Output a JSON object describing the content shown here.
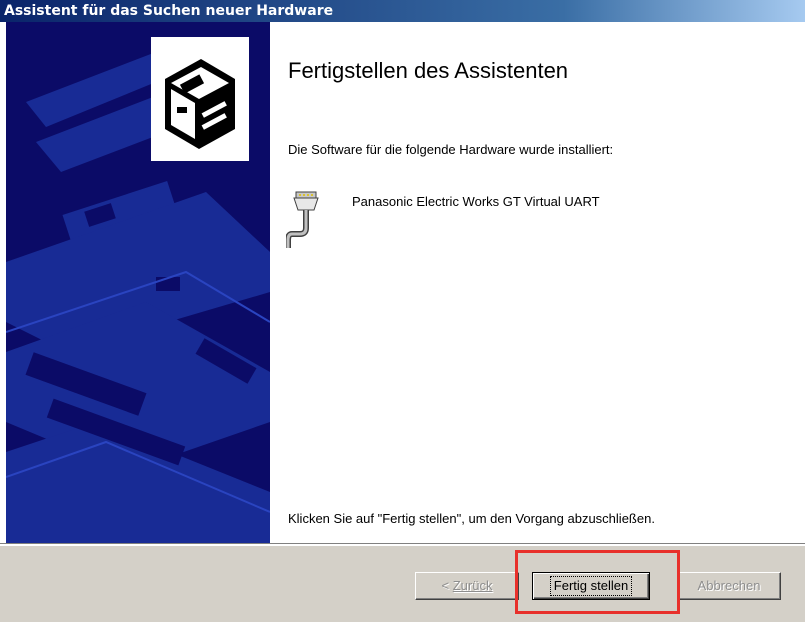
{
  "window": {
    "title": "Assistent für das Suchen neuer Hardware"
  },
  "wizard": {
    "heading": "Fertigstellen des Assistenten",
    "intro": "Die Software für die folgende Hardware wurde installiert:",
    "device_name": "Panasonic Electric Works GT Virtual UART",
    "device_icon": "serial-port-icon",
    "finish_instruction": "Klicken Sie auf \"Fertig stellen\", um den Vorgang abzuschließen."
  },
  "buttons": {
    "back_prefix": "< ",
    "back_label": "Zurück",
    "finish_label": "Fertig stellen",
    "cancel_label": "Abbrechen"
  },
  "colors": {
    "title_bar": "#0a246a",
    "side_panel": "#0b0b67",
    "button_face": "#d4d0c8",
    "highlight": "#e8302b"
  }
}
